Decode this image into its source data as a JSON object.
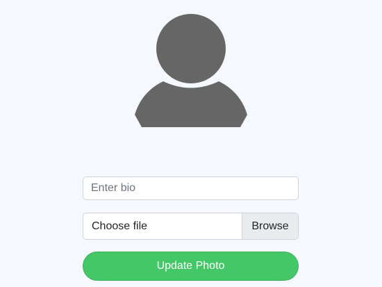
{
  "profile": {
    "avatar_icon": "user-silhouette-icon",
    "avatar_color": "#666666"
  },
  "form": {
    "bio": {
      "value": "",
      "placeholder": "Enter bio"
    },
    "file": {
      "label": "Choose file",
      "browse_label": "Browse"
    },
    "submit_label": "Update Photo",
    "submit_color": "#44c767"
  }
}
